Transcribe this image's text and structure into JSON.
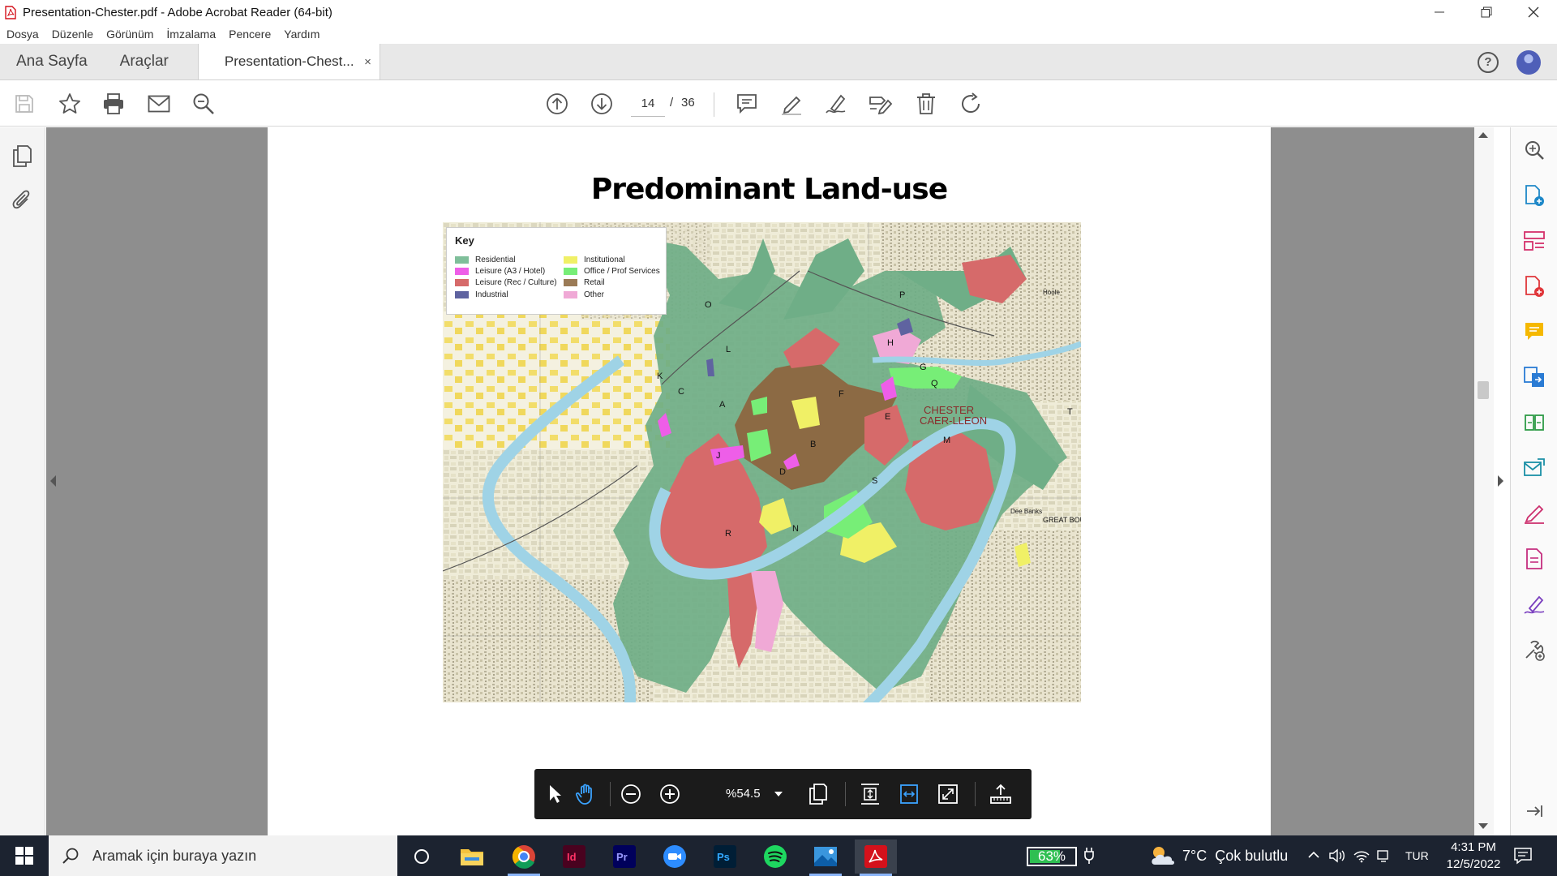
{
  "window": {
    "title": "Presentation-Chester.pdf - Adobe Acrobat Reader (64-bit)"
  },
  "menu": [
    "Dosya",
    "Düzenle",
    "Görünüm",
    "İmzalama",
    "Pencere",
    "Yardım"
  ],
  "tabs": {
    "home": "Ana Sayfa",
    "tools": "Araçlar",
    "document": "Presentation-Chest...",
    "close": "×"
  },
  "toolbar": {
    "current_page": "14",
    "separator": "/",
    "total_pages": "36"
  },
  "document": {
    "slide_title": "Predominant Land-use",
    "map_key": {
      "title": "Key",
      "items": [
        {
          "label": "Residential",
          "color": "#7fbf9a"
        },
        {
          "label": "Leisure (A3 / Hotel)",
          "color": "#ee5ee8"
        },
        {
          "label": "Leisure (Rec / Culture)",
          "color": "#d66a6a"
        },
        {
          "label": "Industrial",
          "color": "#5f63a0"
        },
        {
          "label": "Institutional",
          "color": "#f0f066"
        },
        {
          "label": "Office / Prof Services",
          "color": "#77ee77"
        },
        {
          "label": "Retail",
          "color": "#9b7b56"
        },
        {
          "label": "Other",
          "color": "#f0a9d6"
        }
      ]
    },
    "map_labels": [
      "O",
      "P",
      "L",
      "H",
      "G",
      "K",
      "C",
      "A",
      "F",
      "Q",
      "E",
      "T",
      "CHESTER",
      "CAER-LLEON",
      "M",
      "J",
      "B",
      "D",
      "S",
      "R",
      "N",
      "Dee Banks",
      "GREAT BOU",
      "Hoole"
    ]
  },
  "floating_toolbar": {
    "zoom": "%54.5"
  },
  "taskbar": {
    "search_placeholder": "Aramak için buraya yazın",
    "battery": "63%",
    "weather_temp": "7°C",
    "weather_text": "Çok bulutlu",
    "language": "TUR",
    "time": "4:31 PM",
    "date": "12/5/2022"
  },
  "colors": {
    "acrobat_red": "#d4111b",
    "residential": "#6fae87",
    "retail": "#8c6a44",
    "river": "#9fd3e6"
  }
}
